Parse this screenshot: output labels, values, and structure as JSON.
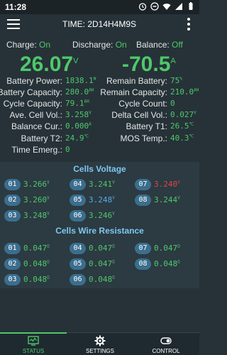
{
  "status_bar": {
    "time": "11:28"
  },
  "app_bar": {
    "title": "TIME: 2D14H4M9S"
  },
  "toggles": {
    "charge": {
      "label": "Charge:",
      "value": "On"
    },
    "discharge": {
      "label": "Discharge:",
      "value": "On"
    },
    "balance": {
      "label": "Balance:",
      "value": "Off"
    }
  },
  "main": {
    "voltage": "26.07",
    "voltage_unit": "V",
    "current": "-70.5",
    "current_unit": "A"
  },
  "params_left": [
    {
      "label": "Battery Power:",
      "value": "1838.1",
      "unit": "W"
    },
    {
      "label": "Battery Capacity:",
      "value": "280.0",
      "unit": "AH"
    },
    {
      "label": "Cycle Capacity:",
      "value": "79.1",
      "unit": "AH"
    },
    {
      "label": "Ave. Cell Vol.:",
      "value": "3.258",
      "unit": "V"
    },
    {
      "label": "Balance Cur.:",
      "value": "0.000",
      "unit": "A"
    },
    {
      "label": "Battery T2:",
      "value": "24.9",
      "unit": "℃"
    },
    {
      "label": "Time Emerg.:",
      "value": "0",
      "unit": ""
    }
  ],
  "params_right": [
    {
      "label": "Remain Battery:",
      "value": "75",
      "unit": "%"
    },
    {
      "label": "Remain Capacity:",
      "value": "210.0",
      "unit": "AH"
    },
    {
      "label": "Cycle Count:",
      "value": "0",
      "unit": ""
    },
    {
      "label": "Delta Cell Vol.:",
      "value": "0.027",
      "unit": "V"
    },
    {
      "label": "Battery T1:",
      "value": "26.5",
      "unit": "℃"
    },
    {
      "label": "MOS Temp.:",
      "value": "40.3",
      "unit": "℃"
    }
  ],
  "cells_voltage": {
    "title": "Cells Voltage",
    "cells": [
      {
        "id": "01",
        "value": "3.266",
        "unit": "V",
        "state": "normal"
      },
      {
        "id": "04",
        "value": "3.241",
        "unit": "V",
        "state": "normal"
      },
      {
        "id": "07",
        "value": "3.240",
        "unit": "V",
        "state": "high"
      },
      {
        "id": "02",
        "value": "3.260",
        "unit": "V",
        "state": "normal"
      },
      {
        "id": "05",
        "value": "3.248",
        "unit": "V",
        "state": "low"
      },
      {
        "id": "08",
        "value": "3.244",
        "unit": "V",
        "state": "normal"
      },
      {
        "id": "03",
        "value": "3.248",
        "unit": "V",
        "state": "normal"
      },
      {
        "id": "06",
        "value": "3.246",
        "unit": "V",
        "state": "normal"
      }
    ]
  },
  "cells_wire": {
    "title": "Cells Wire Resistance",
    "cells": [
      {
        "id": "01",
        "value": "0.047",
        "unit": "Ω"
      },
      {
        "id": "04",
        "value": "0.047",
        "unit": "Ω"
      },
      {
        "id": "07",
        "value": "0.047",
        "unit": "Ω"
      },
      {
        "id": "02",
        "value": "0.048",
        "unit": "Ω"
      },
      {
        "id": "05",
        "value": "0.047",
        "unit": "Ω"
      },
      {
        "id": "08",
        "value": "0.048",
        "unit": "Ω"
      },
      {
        "id": "03",
        "value": "0.048",
        "unit": "Ω"
      },
      {
        "id": "06",
        "value": "0.048",
        "unit": "Ω"
      }
    ]
  },
  "bottom_nav": {
    "status": "STATUS",
    "settings": "SETTINGS",
    "control": "CONTROL"
  },
  "colors": {
    "accent": "#4fc86a",
    "background": "#263238",
    "section_title": "#7ec8f0",
    "high": "#e04545",
    "low": "#5aa8e6"
  }
}
